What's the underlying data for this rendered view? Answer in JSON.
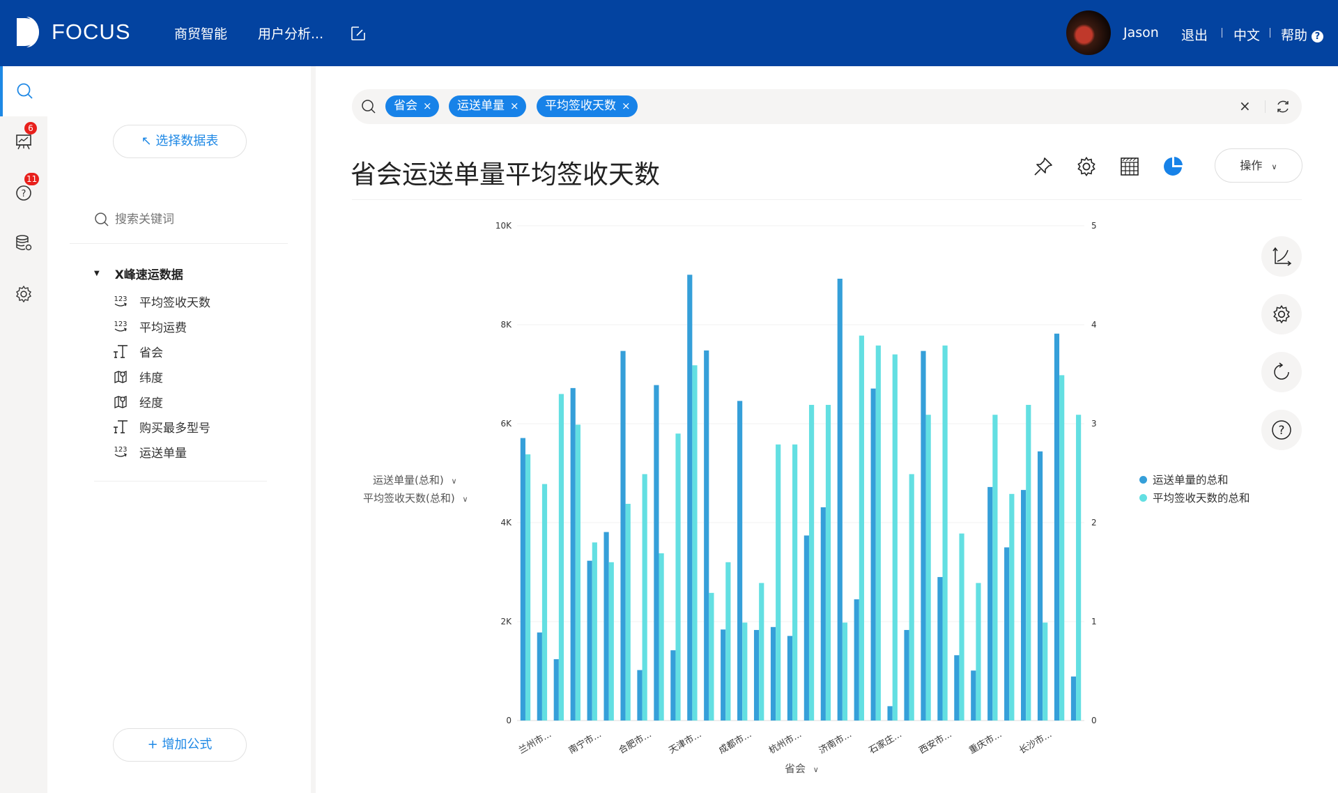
{
  "header": {
    "brand": "FOCUS",
    "nav": [
      "商贸智能",
      "用户分析..."
    ],
    "user_name": "Jason",
    "logout": "退出",
    "language": "中文",
    "help": "帮助",
    "help_icon": "?",
    "colors": {
      "header_bg": "#0343a0",
      "accent": "#1782e8"
    }
  },
  "rail": {
    "items": [
      {
        "name": "search",
        "active": true
      },
      {
        "name": "presentation",
        "badge": "6"
      },
      {
        "name": "question",
        "badge": "11"
      },
      {
        "name": "database-settings"
      },
      {
        "name": "settings"
      }
    ]
  },
  "panel": {
    "select_table_label": "↖ 选择数据表",
    "search_placeholder": "搜索关键词",
    "table_name": "X峰速运数据",
    "fields": [
      {
        "label": "平均签收天数",
        "type": "number"
      },
      {
        "label": "平均运费",
        "type": "number"
      },
      {
        "label": "省会",
        "type": "text"
      },
      {
        "label": "纬度",
        "type": "geo"
      },
      {
        "label": "经度",
        "type": "geo"
      },
      {
        "label": "购买最多型号",
        "type": "text"
      },
      {
        "label": "运送单量",
        "type": "number"
      }
    ],
    "add_formula_label": "+ 增加公式"
  },
  "search": {
    "tokens": [
      "省会",
      "运送单量",
      "平均签收天数"
    ],
    "close_glyph": "×"
  },
  "main": {
    "title": "省会运送单量平均签收天数",
    "ops_label": "操作",
    "y_selectors": [
      "运送单量(总和)",
      "平均签收天数(总和)"
    ],
    "x_selector": "省会"
  },
  "chart_data": {
    "type": "bar",
    "title": "省会运送单量平均签收天数",
    "xlabel": "省会",
    "ylabel_left": "运送单量(总和)",
    "ylabel_right": "平均签收天数(总和)",
    "ylim_left": [
      0,
      10000
    ],
    "ylim_right": [
      0,
      5
    ],
    "yticks_left": [
      "0",
      "2K",
      "4K",
      "6K",
      "8K",
      "10K"
    ],
    "yticks_right": [
      "0",
      "1",
      "2",
      "3",
      "4",
      "5"
    ],
    "grid": true,
    "legend_position": "right",
    "x_tick_labels": [
      "兰州市...",
      "南宁市...",
      "合肥市...",
      "天津市...",
      "成都市...",
      "杭州市...",
      "济南市...",
      "石家庄...",
      "西安市...",
      "重庆市...",
      "长沙市..."
    ],
    "x_tick_every": 3,
    "x_tick_offset": 1,
    "series": [
      {
        "name": "运送单量的总和",
        "axis": "left",
        "color": "#359fd9",
        "values": [
          5710,
          1780,
          1240,
          6720,
          3230,
          3810,
          7470,
          1020,
          6780,
          1420,
          9010,
          7480,
          1840,
          6460,
          1830,
          1890,
          1710,
          3740,
          4310,
          8930,
          2450,
          6710,
          290,
          1830,
          7470,
          2900,
          1320,
          1010,
          4720,
          3500,
          4660,
          5440,
          7820,
          890
        ]
      },
      {
        "name": "平均签收天数的总和",
        "axis": "right",
        "color": "#63dfe2",
        "values": [
          2.69,
          2.39,
          3.3,
          2.99,
          1.8,
          1.6,
          2.19,
          2.49,
          1.69,
          2.9,
          3.59,
          1.29,
          1.6,
          0.99,
          1.39,
          2.79,
          2.79,
          3.19,
          3.19,
          0.99,
          3.89,
          3.79,
          3.7,
          2.49,
          3.09,
          3.79,
          1.89,
          1.39,
          3.09,
          2.29,
          3.19,
          0.99,
          3.49,
          3.09
        ]
      }
    ]
  }
}
